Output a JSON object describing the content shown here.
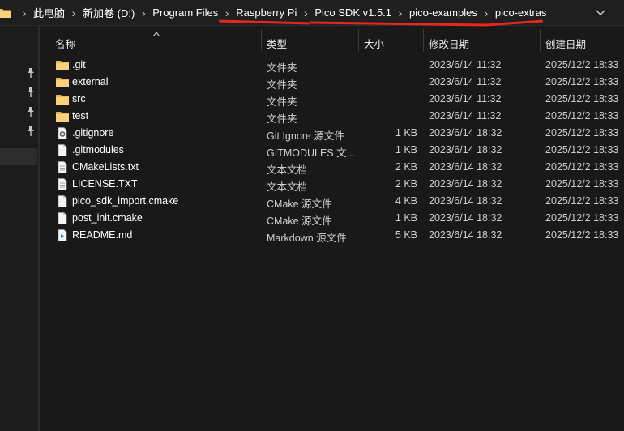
{
  "breadcrumb": {
    "items": [
      "此电脑",
      "新加卷 (D:)",
      "Program Files",
      "Raspberry Pi",
      "Pico SDK v1.5.1",
      "pico-examples",
      "pico-extras"
    ],
    "separator": "›"
  },
  "columns": {
    "name": "名称",
    "type": "类型",
    "size": "大小",
    "modified": "修改日期",
    "created": "创建日期"
  },
  "files": [
    {
      "name": ".git",
      "type": "文件夹",
      "size": "",
      "modified": "2023/6/14 11:32",
      "created": "2025/12/2 18:33",
      "icon": "folder-icon"
    },
    {
      "name": "external",
      "type": "文件夹",
      "size": "",
      "modified": "2023/6/14 11:32",
      "created": "2025/12/2 18:33",
      "icon": "folder-icon"
    },
    {
      "name": "src",
      "type": "文件夹",
      "size": "",
      "modified": "2023/6/14 11:32",
      "created": "2025/12/2 18:33",
      "icon": "folder-icon"
    },
    {
      "name": "test",
      "type": "文件夹",
      "size": "",
      "modified": "2023/6/14 11:32",
      "created": "2025/12/2 18:33",
      "icon": "folder-icon"
    },
    {
      "name": ".gitignore",
      "type": "Git Ignore 源文件",
      "size": "1 KB",
      "modified": "2023/6/14 18:32",
      "created": "2025/12/2 18:33",
      "icon": "gear-file-icon"
    },
    {
      "name": ".gitmodules",
      "type": "GITMODULES 文...",
      "size": "1 KB",
      "modified": "2023/6/14 18:32",
      "created": "2025/12/2 18:33",
      "icon": "file-icon"
    },
    {
      "name": "CMakeLists.txt",
      "type": "文本文档",
      "size": "2 KB",
      "modified": "2023/6/14 18:32",
      "created": "2025/12/2 18:33",
      "icon": "text-file-icon"
    },
    {
      "name": "LICENSE.TXT",
      "type": "文本文档",
      "size": "2 KB",
      "modified": "2023/6/14 18:32",
      "created": "2025/12/2 18:33",
      "icon": "text-file-icon"
    },
    {
      "name": "pico_sdk_import.cmake",
      "type": "CMake 源文件",
      "size": "4 KB",
      "modified": "2023/6/14 18:32",
      "created": "2025/12/2 18:33",
      "icon": "file-icon"
    },
    {
      "name": "post_init.cmake",
      "type": "CMake 源文件",
      "size": "1 KB",
      "modified": "2023/6/14 18:32",
      "created": "2025/12/2 18:33",
      "icon": "file-icon"
    },
    {
      "name": "README.md",
      "type": "Markdown 源文件",
      "size": "5 KB",
      "modified": "2023/6/14 18:32",
      "created": "2025/12/2 18:33",
      "icon": "markdown-file-icon"
    }
  ],
  "colors": {
    "background": "#191919",
    "annotation": "#e8261c",
    "folder": "#f2c55c"
  }
}
